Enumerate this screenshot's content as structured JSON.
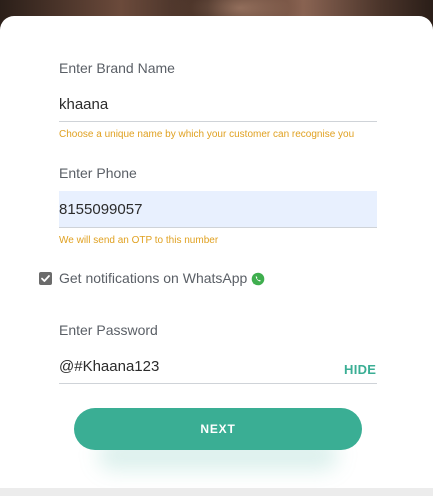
{
  "form": {
    "brand": {
      "label": "Enter Brand Name",
      "value": "khaana",
      "hint": "Choose a unique name by which your customer can recognise you"
    },
    "phone": {
      "label": "Enter Phone",
      "value": "8155099057",
      "hint": "We will send an OTP to this number"
    },
    "whatsapp": {
      "label": "Get notifications on WhatsApp",
      "checked": true,
      "icon": "whatsapp-icon"
    },
    "password": {
      "label": "Enter Password",
      "value": "@#Khaana123",
      "toggle_label": "HIDE"
    },
    "next_label": "NEXT"
  },
  "colors": {
    "accent": "#3aae94",
    "hint": "#e0a121",
    "autofill_bg": "#e8f0fe",
    "label": "#5a5f66"
  }
}
